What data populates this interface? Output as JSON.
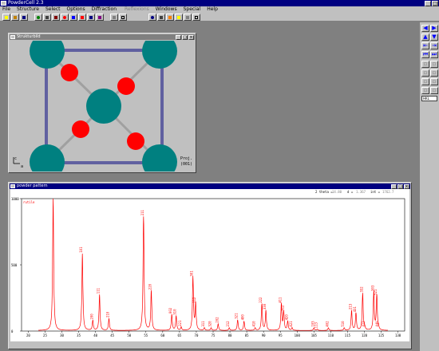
{
  "app": {
    "title": "PowderCell 2.3"
  },
  "menu": [
    "File",
    "Structure",
    "Select",
    "Options",
    "Diffraction",
    "Reflexions",
    "Windows",
    "Special",
    "Help"
  ],
  "structure_window": {
    "title": "Strukturbild",
    "projection_label": "Proj.",
    "projection_value": "(001)",
    "axis_c": "c",
    "axis_a": "a"
  },
  "pattern_window": {
    "title": "powder pattern",
    "readout": {
      "two_theta_label": "2 theta =",
      "two_theta_value": "14.80",
      "d_label": "d =",
      "d_value": "1.367",
      "int_label": "int =",
      "int_value": "1762.7"
    },
    "series_name": "rutile"
  },
  "right_panel": {
    "select_value": "HKL"
  },
  "colors": {
    "titlebar": "#000080",
    "inactive_title": "#808080",
    "line": "#ff0000",
    "teal": "#008080",
    "red": "#ff0000",
    "box": "#000080"
  },
  "chart_data": {
    "type": "line",
    "series": [
      {
        "name": "rutile"
      }
    ],
    "xlim": [
      18,
      132
    ],
    "ylim": [
      0,
      1000
    ],
    "x_ticks": [
      20,
      25,
      30,
      35,
      40,
      45,
      50,
      55,
      60,
      65,
      70,
      75,
      80,
      85,
      90,
      95,
      100,
      105,
      110,
      115,
      120,
      125,
      130
    ],
    "y_ticks": [
      {
        "value": 1000,
        "label": "1000"
      },
      {
        "value": 500,
        "label": "500"
      },
      {
        "value": 0,
        "label": "0"
      }
    ],
    "peaks": [
      {
        "x": 27.4,
        "y": 1000,
        "label": ""
      },
      {
        "x": 36.1,
        "y": 580,
        "label": "101"
      },
      {
        "x": 39.2,
        "y": 75,
        "label": "200"
      },
      {
        "x": 41.2,
        "y": 270,
        "label": "111"
      },
      {
        "x": 44.0,
        "y": 90,
        "label": "210"
      },
      {
        "x": 54.3,
        "y": 860,
        "label": "211"
      },
      {
        "x": 56.6,
        "y": 300,
        "label": "220"
      },
      {
        "x": 62.7,
        "y": 120,
        "label": "002"
      },
      {
        "x": 64.0,
        "y": 110,
        "label": "310"
      },
      {
        "x": 65.5,
        "y": 25,
        "label": "221"
      },
      {
        "x": 69.0,
        "y": 400,
        "label": "301"
      },
      {
        "x": 69.8,
        "y": 200,
        "label": "112"
      },
      {
        "x": 72.4,
        "y": 20,
        "label": "311"
      },
      {
        "x": 74.4,
        "y": 20,
        "label": "320"
      },
      {
        "x": 76.5,
        "y": 50,
        "label": "202"
      },
      {
        "x": 79.8,
        "y": 20,
        "label": "212"
      },
      {
        "x": 82.3,
        "y": 80,
        "label": "321"
      },
      {
        "x": 84.2,
        "y": 70,
        "label": "400"
      },
      {
        "x": 87.5,
        "y": 20,
        "label": "410"
      },
      {
        "x": 89.5,
        "y": 200,
        "label": "222"
      },
      {
        "x": 90.7,
        "y": 150,
        "label": "330"
      },
      {
        "x": 95.3,
        "y": 200,
        "label": "411"
      },
      {
        "x": 96.0,
        "y": 140,
        "label": "312"
      },
      {
        "x": 97.2,
        "y": 70,
        "label": "420"
      },
      {
        "x": 98.5,
        "y": 20,
        "label": "421"
      },
      {
        "x": 105.0,
        "y": 20,
        "label": "103"
      },
      {
        "x": 106.0,
        "y": 10,
        "label": "113"
      },
      {
        "x": 109.3,
        "y": 20,
        "label": "402"
      },
      {
        "x": 114.0,
        "y": 20,
        "label": "510"
      },
      {
        "x": 116.2,
        "y": 150,
        "label": "213"
      },
      {
        "x": 117.5,
        "y": 130,
        "label": "431"
      },
      {
        "x": 119.5,
        "y": 280,
        "label": "332"
      },
      {
        "x": 120.1,
        "y": 20,
        "label": "422"
      },
      {
        "x": 122.8,
        "y": 290,
        "label": "303"
      },
      {
        "x": 123.7,
        "y": 260,
        "label": "521"
      },
      {
        "x": 124.2,
        "y": 20,
        "label": "440"
      }
    ]
  }
}
